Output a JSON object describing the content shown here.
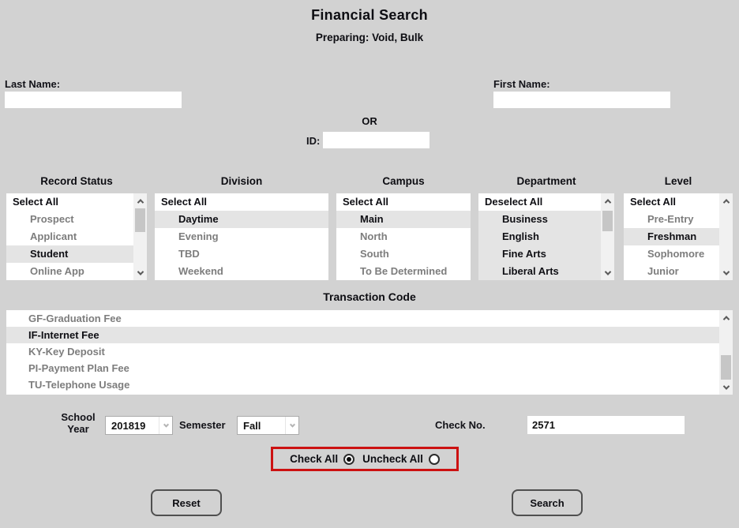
{
  "colors": {
    "background": "#d2d2d2",
    "row_highlight": "#e4e4e4",
    "muted_text": "#7d7d7d",
    "dark_text": "#121218",
    "alert_border": "#cc1111",
    "scroll_track": "#f1f1f1",
    "scroll_thumb": "#c6c6c6"
  },
  "header": {
    "title": "Financial Search",
    "subtitle": "Preparing: Void, Bulk"
  },
  "fields": {
    "last_name": {
      "label": "Last Name:",
      "value": ""
    },
    "first_name": {
      "label": "First Name:",
      "value": ""
    },
    "or_label": "OR",
    "id": {
      "label": "ID:",
      "value": ""
    }
  },
  "listboxes": [
    {
      "title": "Record Status",
      "items": [
        {
          "label": "Select All",
          "style": "action"
        },
        {
          "label": "Prospect",
          "style": "normal"
        },
        {
          "label": "Applicant",
          "style": "normal"
        },
        {
          "label": "Student",
          "style": "selected"
        },
        {
          "label": "Online App",
          "style": "normal"
        }
      ]
    },
    {
      "title": "Division",
      "items": [
        {
          "label": "Select All",
          "style": "action"
        },
        {
          "label": "Daytime",
          "style": "selected"
        },
        {
          "label": "Evening",
          "style": "normal"
        },
        {
          "label": "TBD",
          "style": "normal"
        },
        {
          "label": "Weekend",
          "style": "normal"
        }
      ]
    },
    {
      "title": "Campus",
      "items": [
        {
          "label": "Select All",
          "style": "action"
        },
        {
          "label": "Main",
          "style": "selected"
        },
        {
          "label": "North",
          "style": "normal"
        },
        {
          "label": "South",
          "style": "normal"
        },
        {
          "label": "To Be Determined",
          "style": "normal"
        }
      ]
    },
    {
      "title": "Department",
      "items": [
        {
          "label": "Deselect All",
          "style": "action"
        },
        {
          "label": "Business",
          "style": "selected"
        },
        {
          "label": "English",
          "style": "selected"
        },
        {
          "label": "Fine Arts",
          "style": "selected"
        },
        {
          "label": "Liberal Arts",
          "style": "selected"
        }
      ]
    },
    {
      "title": "Level",
      "items": [
        {
          "label": "Select All",
          "style": "action"
        },
        {
          "label": "Pre-Entry",
          "style": "normal"
        },
        {
          "label": "Freshman",
          "style": "selected"
        },
        {
          "label": "Sophomore",
          "style": "normal"
        },
        {
          "label": "Junior",
          "style": "normal"
        }
      ]
    }
  ],
  "transaction": {
    "title": "Transaction Code",
    "items": [
      {
        "label": "GF-Graduation Fee",
        "style": "normal"
      },
      {
        "label": "IF-Internet Fee",
        "style": "selected"
      },
      {
        "label": "KY-Key Deposit",
        "style": "normal"
      },
      {
        "label": "PI-Payment Plan Fee",
        "style": "normal"
      },
      {
        "label": "TU-Telephone Usage",
        "style": "normal"
      }
    ]
  },
  "filters": {
    "school_year": {
      "label_line1": "School",
      "label_line2": "Year",
      "value": "201819"
    },
    "semester": {
      "label": "Semester",
      "value": "Fall"
    },
    "check_no": {
      "label": "Check No.",
      "value": "2571"
    }
  },
  "radio_group": {
    "check_all": {
      "label": "Check All",
      "checked": true
    },
    "uncheck_all": {
      "label": "Uncheck All",
      "checked": false
    }
  },
  "buttons": {
    "reset": "Reset",
    "search": "Search"
  }
}
